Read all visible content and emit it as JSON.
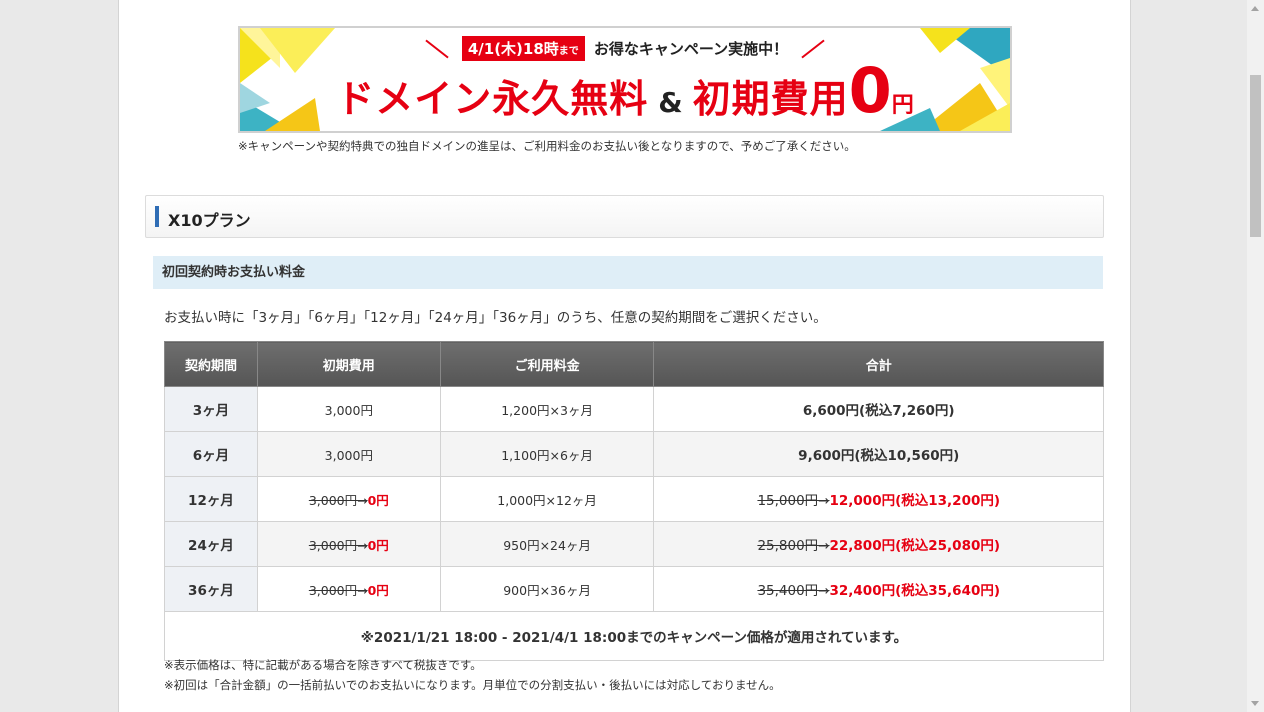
{
  "banner": {
    "date_main": "4/1(木)18時",
    "date_suffix": "まで",
    "promo_text": "お得なキャンペーン実施中！",
    "headline_part1": "ドメイン永久無料",
    "ampersand": "&",
    "headline_part2": "初期費用",
    "zero": "0",
    "yen": "円",
    "note": "※キャンペーンや契約特典での独自ドメインの進呈は、ご利用料金のお支払い後となりますので、予めご了承ください。"
  },
  "plan": {
    "title": "X10プラン",
    "subhead": "初回契約時お支払い料金",
    "intro": "お支払い時に「3ヶ月」「6ヶ月」「12ヶ月」「24ヶ月」「36ヶ月」のうち、任意の契約期間をご選択ください。"
  },
  "table": {
    "headers": [
      "契約期間",
      "初期費用",
      "ご利用料金",
      "合計"
    ],
    "rows": [
      {
        "period": "3ヶ月",
        "initial": "3,000円",
        "initial_old": "",
        "initial_new": "",
        "usage": "1,200円×3ヶ月",
        "total": "6,600円(税込7,260円)",
        "total_old": "",
        "total_new": ""
      },
      {
        "period": "6ヶ月",
        "initial": "3,000円",
        "initial_old": "",
        "initial_new": "",
        "usage": "1,100円×6ヶ月",
        "total": "9,600円(税込10,560円)",
        "total_old": "",
        "total_new": ""
      },
      {
        "period": "12ヶ月",
        "initial": "",
        "initial_old": "3,000円→",
        "initial_new": "0円",
        "usage": "1,000円×12ヶ月",
        "total": "",
        "total_old": "15,000円→",
        "total_new": "12,000円(税込13,200円)"
      },
      {
        "period": "24ヶ月",
        "initial": "",
        "initial_old": "3,000円→",
        "initial_new": "0円",
        "usage": "950円×24ヶ月",
        "total": "",
        "total_old": "25,800円→",
        "total_new": "22,800円(税込25,080円)"
      },
      {
        "period": "36ヶ月",
        "initial": "",
        "initial_old": "3,000円→",
        "initial_new": "0円",
        "usage": "900円×36ヶ月",
        "total": "",
        "total_old": "35,400円→",
        "total_new": "32,400円(税込35,640円)"
      }
    ],
    "campaign_note": "※2021/1/21 18:00 - 2021/4/1 18:00までのキャンペーン価格が適用されています。"
  },
  "notes": [
    "※表示価格は、特に記載がある場合を除きすべて税抜きです。",
    "※初回は「合計金額」の一括前払いでのお支払いになります。月単位での分割支払い・後払いには対応しておりません。"
  ],
  "colors": {
    "accent_red": "#e60012",
    "plan_bar_blue": "#2f6db5",
    "subhead_bg": "#dfeef7",
    "table_header_bg": "#5f5f5f"
  }
}
